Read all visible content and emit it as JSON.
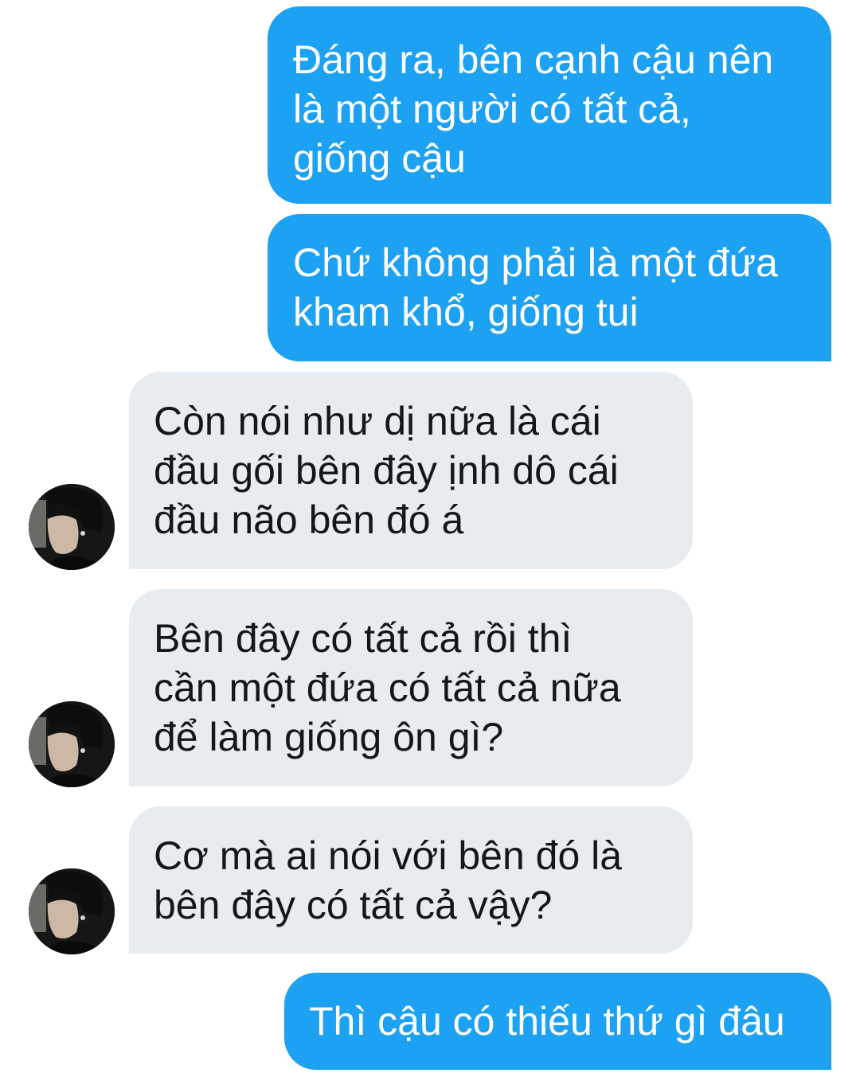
{
  "conversation": {
    "messages": [
      {
        "sender": "me",
        "lines": [
          "Đáng ra, bên cạnh cậu nên",
          "là một người có tất cả,",
          "giống cậu"
        ]
      },
      {
        "sender": "me",
        "lines": [
          "Chứ không phải là một đứa",
          "kham khổ, giống tui"
        ]
      },
      {
        "sender": "other",
        "lines": [
          "Còn nói như dị nữa là cái",
          "đầu gối bên đây ịnh dô cái",
          "đầu não bên đó á"
        ]
      },
      {
        "sender": "other",
        "lines": [
          "Bên đây có tất cả rồi thì",
          "cần một đứa có tất cả nữa",
          "để làm giống ôn gì?"
        ]
      },
      {
        "sender": "other",
        "lines": [
          "Cơ mà ai nói với bên đó là",
          "bên đây có tất cả vậy?"
        ]
      },
      {
        "sender": "me",
        "lines": [
          "Thì cậu có thiếu thứ gì đâu"
        ]
      }
    ],
    "avatar_icon": "profile-photo-avatar-icon"
  },
  "colors": {
    "sent_bubble": "#1da1f2",
    "received_bubble": "#e6ecf0",
    "sent_text": "#ffffff",
    "received_text": "#14171a"
  }
}
